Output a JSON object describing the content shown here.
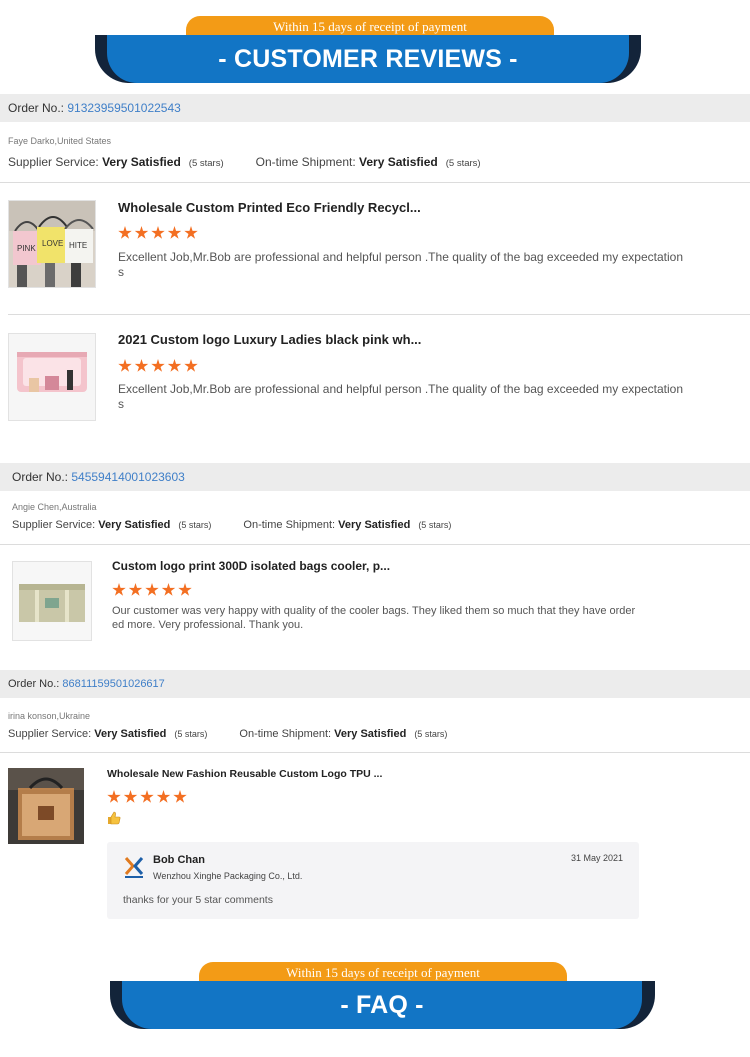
{
  "banners": {
    "reviews": {
      "tab": "Within 15 days of receipt of payment",
      "title": "- CUSTOMER REVIEWS -"
    },
    "faq": {
      "tab": "Within 15 days of receipt of payment",
      "title": "- FAQ -"
    }
  },
  "labels": {
    "order_no": "Order No.:",
    "supplier_service": "Supplier Service:",
    "ontime_shipment": "On-time Shipment:"
  },
  "orders": [
    {
      "order_no": "91323959501022543",
      "buyer": "Faye Darko,United States",
      "supplier_value": "Very Satisfied",
      "supplier_stars": "(5 stars)",
      "shipment_value": "Very Satisfied",
      "shipment_stars": "(5 stars)",
      "items": [
        {
          "title": "Wholesale Custom Printed Eco Friendly Recycl...",
          "rating": 5,
          "comment_line1": "Excellent Job,Mr.Bob are professional and helpful person .The quality of the bag exceeded my expectation",
          "comment_line2": "s"
        },
        {
          "title": "2021 Custom logo Luxury Ladies black pink wh...",
          "rating": 5,
          "comment_line1": "Excellent Job,Mr.Bob are professional and helpful person .The quality of the bag exceeded my expectation",
          "comment_line2": "s"
        }
      ]
    },
    {
      "order_no": "54559414001023603",
      "buyer": "Angie Chen,Australia",
      "supplier_value": "Very Satisfied",
      "supplier_stars": "(5 stars)",
      "shipment_value": "Very Satisfied",
      "shipment_stars": "(5 stars)",
      "items": [
        {
          "title": "Custom logo print 300D isolated bags cooler, p...",
          "rating": 5,
          "comment_line1": "Our customer was very happy with quality of the cooler bags. They liked them so much that they have order",
          "comment_line2": "ed more. Very professional. Thank you."
        }
      ]
    },
    {
      "order_no": "86811159501026617",
      "buyer": "irina konson,Ukraine",
      "supplier_value": "Very Satisfied",
      "supplier_stars": "(5 stars)",
      "shipment_value": "Very Satisfied",
      "shipment_stars": "(5 stars)",
      "items": [
        {
          "title": "Wholesale New Fashion Reusable Custom Logo TPU ...",
          "rating": 5,
          "comment_icon": "thumbs-up-icon",
          "reply": {
            "name": "Bob Chan",
            "company": "Wenzhou Xinghe Packaging Co., Ltd.",
            "date": "31 May 2021",
            "text": "thanks for your 5 star comments"
          }
        }
      ]
    }
  ],
  "colors": {
    "accent_blue": "#1275c5",
    "accent_orange": "#f39b16",
    "star": "#f36f22",
    "link": "#3f7fc8"
  }
}
